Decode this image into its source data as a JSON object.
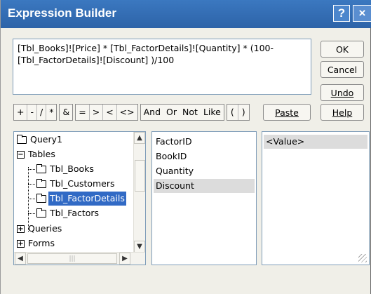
{
  "window": {
    "title": "Expression Builder",
    "help_glyph": "?",
    "close_glyph": "×"
  },
  "expression": {
    "text": "[Tbl_Books]![Price] * [Tbl_FactorDetails]![Quantity] * (100-[Tbl_FactorDetails]![Discount] )/100"
  },
  "buttons": {
    "ok": "OK",
    "cancel": "Cancel",
    "undo": "Undo",
    "paste": "Paste",
    "help": "Help"
  },
  "operators": {
    "arith": [
      "+",
      "-",
      "/",
      "*"
    ],
    "concat": "&",
    "compare": [
      "=",
      ">",
      "<",
      "<>"
    ],
    "logical": [
      "And",
      "Or",
      "Not",
      "Like"
    ],
    "parens": [
      "(",
      ")"
    ]
  },
  "tree": {
    "items": [
      {
        "label": "Query1",
        "icon": "folder-icon"
      },
      {
        "label": "Tables",
        "icon": "minus-box-icon",
        "sign": "−"
      },
      {
        "label": "Tbl_Books",
        "icon": "folder-icon"
      },
      {
        "label": "Tbl_Customers",
        "icon": "folder-icon"
      },
      {
        "label": "Tbl_FactorDetails",
        "icon": "open-folder-icon"
      },
      {
        "label": "Tbl_Factors",
        "icon": "folder-icon"
      },
      {
        "label": "Queries",
        "icon": "plus-box-icon",
        "sign": "+"
      },
      {
        "label": "Forms",
        "icon": "plus-box-icon",
        "sign": "+"
      }
    ]
  },
  "fields": {
    "items": [
      "FactorID",
      "BookID",
      "Quantity",
      "Discount"
    ],
    "selected": "Discount"
  },
  "values": {
    "items": [
      "<Value>"
    ]
  },
  "scroll": {
    "up": "▲",
    "down": "▼",
    "left": "◀",
    "right": "▶",
    "grip": "|||"
  }
}
